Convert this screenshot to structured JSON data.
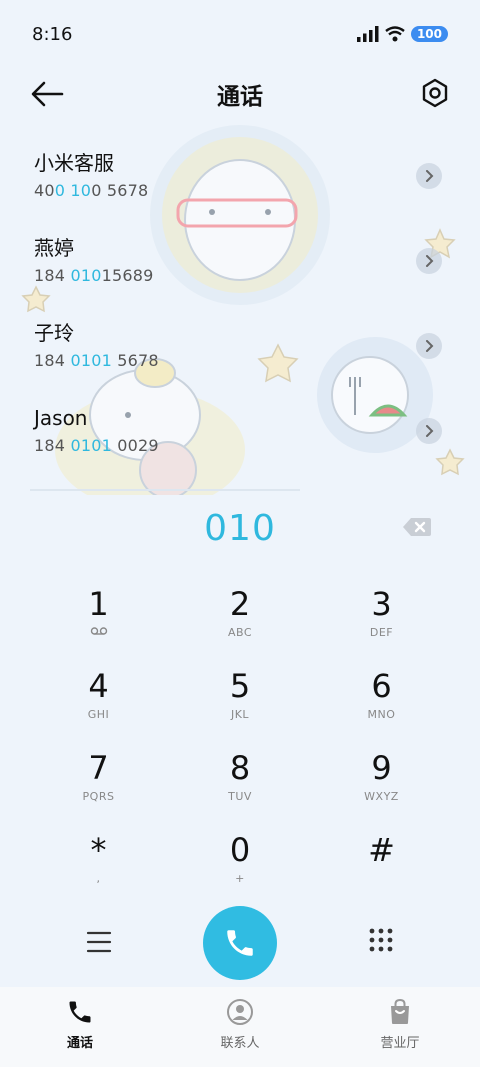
{
  "status": {
    "time": "8:16",
    "battery": "100"
  },
  "header": {
    "title": "通话"
  },
  "contacts": [
    {
      "name": "小米客服",
      "number_parts": [
        "40",
        "0 10",
        "0 5678"
      ]
    },
    {
      "name": "燕婷",
      "number_parts": [
        "184 ",
        "010",
        "15689"
      ]
    },
    {
      "name": "子玲",
      "number_parts": [
        "184 ",
        "0101",
        " 5678"
      ]
    },
    {
      "name": "Jason",
      "number_parts": [
        "184 ",
        "0101",
        " 0029"
      ]
    }
  ],
  "dial": {
    "digits": "010"
  },
  "keypad": [
    {
      "digit": "1",
      "letters": ""
    },
    {
      "digit": "2",
      "letters": "ABC"
    },
    {
      "digit": "3",
      "letters": "DEF"
    },
    {
      "digit": "4",
      "letters": "GHI"
    },
    {
      "digit": "5",
      "letters": "JKL"
    },
    {
      "digit": "6",
      "letters": "MNO"
    },
    {
      "digit": "7",
      "letters": "PQRS"
    },
    {
      "digit": "8",
      "letters": "TUV"
    },
    {
      "digit": "9",
      "letters": "WXYZ"
    },
    {
      "digit": "*",
      "letters": ","
    },
    {
      "digit": "0",
      "letters": "+"
    },
    {
      "digit": "#",
      "letters": ""
    }
  ],
  "nav": {
    "calls_label": "通话",
    "contacts_label": "联系人",
    "store_label": "营业厅"
  },
  "colors": {
    "accent": "#30bce2",
    "highlight": "#2fb8de",
    "battery": "#3c8cf0"
  }
}
